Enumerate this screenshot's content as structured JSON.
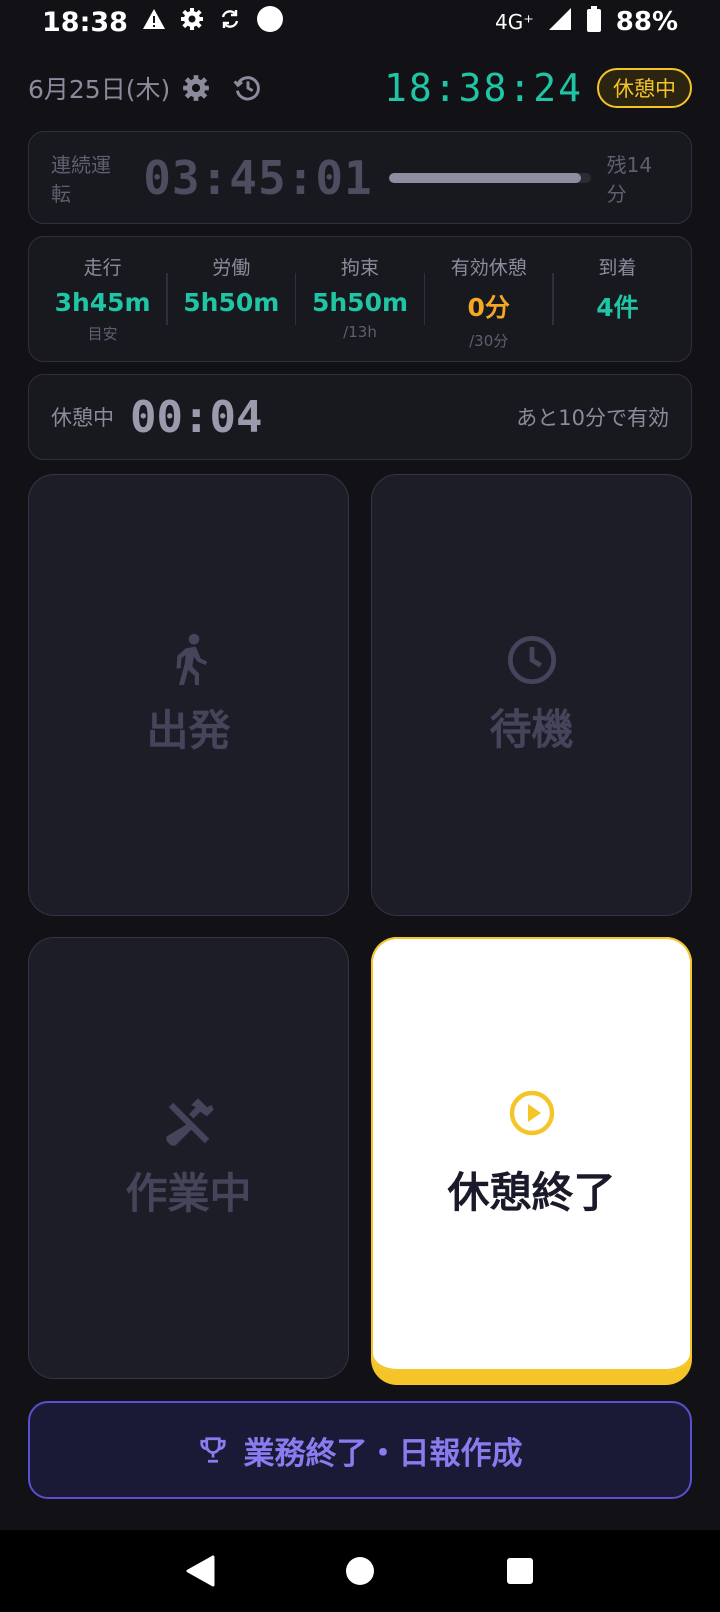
{
  "status_bar": {
    "time": "18:38",
    "network": "4G⁺",
    "battery": "88%"
  },
  "header": {
    "date": "6月25日(木)",
    "clock": "18:38:24",
    "status": "休憩中"
  },
  "drive": {
    "label": "連続運転",
    "time": "03:45:01",
    "remaining": "残14分",
    "progress": 0.95
  },
  "stats": [
    {
      "label": "走行",
      "value": "3h45m",
      "sub": "目安",
      "color": "#20c5a6"
    },
    {
      "label": "労働",
      "value": "5h50m",
      "sub": "",
      "color": "#20c5a6"
    },
    {
      "label": "拘束",
      "value": "5h50m",
      "sub": "/13h",
      "color": "#20c5a6"
    },
    {
      "label": "有効休憩",
      "value": "0分",
      "sub": "/30分",
      "color": "#f5a623"
    },
    {
      "label": "到着",
      "value": "4件",
      "sub": "",
      "color": "#20c5a6"
    }
  ],
  "break": {
    "label": "休憩中",
    "time": "00:04",
    "note": "あと10分で有効"
  },
  "actions": {
    "depart": {
      "label": "出発",
      "icon": "walking-person-icon"
    },
    "standby": {
      "label": "待機",
      "icon": "clock-icon"
    },
    "working": {
      "label": "作業中",
      "icon": "hammer-wrench-icon"
    },
    "end_break": {
      "label": "休憩終了",
      "icon": "play-circle-icon"
    }
  },
  "end_button": {
    "label": "業務終了・日報作成",
    "icon": "trophy-icon"
  },
  "colors": {
    "accent_teal": "#20c5a6",
    "accent_yellow": "#f5c428",
    "accent_orange": "#f5a623",
    "accent_purple": "#8a7cf0",
    "background": "#111116"
  }
}
